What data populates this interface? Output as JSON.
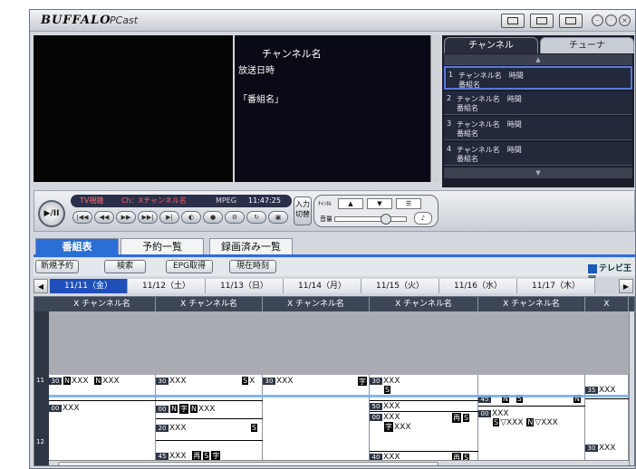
{
  "window": {
    "brand": "BUFFALO",
    "product": "PCast"
  },
  "info": {
    "channel_name": "チャンネル名",
    "airdate": "放送日時",
    "program": "「番組名」"
  },
  "channel_panel": {
    "tabs": [
      "チャンネル",
      "チューナ"
    ],
    "items": [
      {
        "num": "1",
        "line1": "チャンネル名　時間",
        "line2": "番組名"
      },
      {
        "num": "2",
        "line1": "チャンネル名　時間",
        "line2": "番組名"
      },
      {
        "num": "3",
        "line1": "チャンネル名　時間",
        "line2": "番組名"
      },
      {
        "num": "4",
        "line1": "チャンネル名　時間",
        "line2": "番組名"
      }
    ]
  },
  "controls": {
    "play": "▶/II",
    "lcd_mode": "TV視聴",
    "lcd_channel": "Ch：Xチャンネル名",
    "lcd_format": "MPEG",
    "lcd_time": "11:47:25",
    "input_label": "入力切替",
    "channel_label": "ﾁｬﾝﾈﾙ",
    "volume_label": "音量"
  },
  "main_tabs": [
    "番組表",
    "予約一覧",
    "録画済み一覧"
  ],
  "toolbar": {
    "buttons": [
      "新規予約",
      "検索",
      "EPG取得",
      "現在時刻"
    ],
    "tv_logo": "テレビ王国"
  },
  "dates": [
    "11/11（金）",
    "11/12（土）",
    "11/13（日）",
    "11/14（月）",
    "11/15（火）",
    "11/16（水）",
    "11/17（木）"
  ],
  "columns": [
    "X チャンネル名",
    "X チャンネル名",
    "X チャンネル名",
    "X チャンネル名",
    "X チャンネル名",
    "X"
  ],
  "hours": [
    "11",
    "12"
  ],
  "programs": {
    "c1": [
      "N",
      "XXX",
      "N",
      "XXX",
      "XXX"
    ],
    "c2": [
      "XXX",
      "S",
      "X",
      "N",
      "字",
      "N",
      "XXX",
      "XXX",
      "S",
      "XXX",
      "再",
      "S",
      "字"
    ],
    "c3": [
      "XXX",
      "字"
    ],
    "c4": [
      "XXX",
      "S",
      "XXX",
      "XXX",
      "再",
      "S",
      "字",
      "XXX",
      "XXX",
      "再",
      "S"
    ],
    "c5": [
      "N",
      "S",
      "N",
      "XXX",
      "S",
      "▽XXX",
      "N",
      "▽XXX"
    ],
    "c6": [
      "XXX",
      "XXX"
    ],
    "minutes": [
      "30",
      "00",
      "20",
      "45",
      "50",
      "35",
      "40"
    ]
  }
}
